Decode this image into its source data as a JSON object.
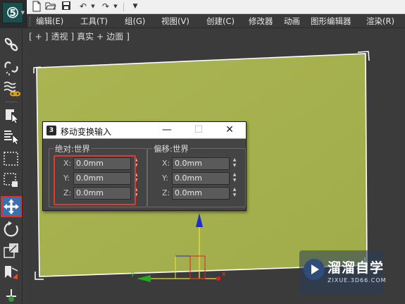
{
  "quick_access": {
    "icons": [
      "new-file-icon",
      "open-folder-icon",
      "save-icon",
      "undo-icon",
      "redo-icon",
      "customize-icon"
    ]
  },
  "menu": {
    "items": [
      "编辑(E)",
      "工具(T)",
      "组(G)",
      "视图(V)",
      "创建(C)",
      "修改器",
      "动画",
      "图形编辑器",
      "渲染(R)"
    ]
  },
  "left_toolbar": {
    "icons": [
      "link-icon",
      "unlink-icon",
      "bind-space-warp-icon",
      "select-object-icon",
      "select-by-name-icon",
      "rectangle-region-icon",
      "window-crossing-icon",
      "move-icon",
      "rotate-icon",
      "scale-icon",
      "mirror-icon",
      "snap-icon"
    ],
    "active": "move-icon"
  },
  "viewport": {
    "label_parts": [
      "[ + ]",
      "[ 透视 ]",
      "[ 真实 + 边面 ]"
    ],
    "label_display": [
      "[",
      "+",
      "]",
      "透视",
      "]",
      "真实",
      "+",
      "边面",
      "]"
    ],
    "plane_color": "#a5b24f",
    "gizmo": {
      "x_label": "x",
      "y_label": "y"
    }
  },
  "dialog": {
    "title": "移动变换输入",
    "minimize": "—",
    "maximize": "☐",
    "close": "✕",
    "absolute": {
      "label": "绝对:世界",
      "x_label": "X:",
      "x_value": "0.0mm",
      "y_label": "Y:",
      "y_value": "0.0mm",
      "z_label": "Z:",
      "z_value": "0.0mm"
    },
    "offset": {
      "label": "偏移:世界",
      "x_label": "X:",
      "x_value": "0.0mm",
      "y_label": "Y:",
      "y_value": "0.0mm",
      "z_label": "Z:",
      "z_value": "0.0mm"
    }
  },
  "watermark": {
    "title": "溜溜自学",
    "subtitle": "ZIXUE.3D66.COM"
  },
  "colors": {
    "accent_highlight": "#e03a30",
    "active_tool_bg": "#3a6fb0",
    "gizmo_x": "#e02020",
    "gizmo_y": "#22aa22",
    "gizmo_z": "#1a2fd0"
  }
}
